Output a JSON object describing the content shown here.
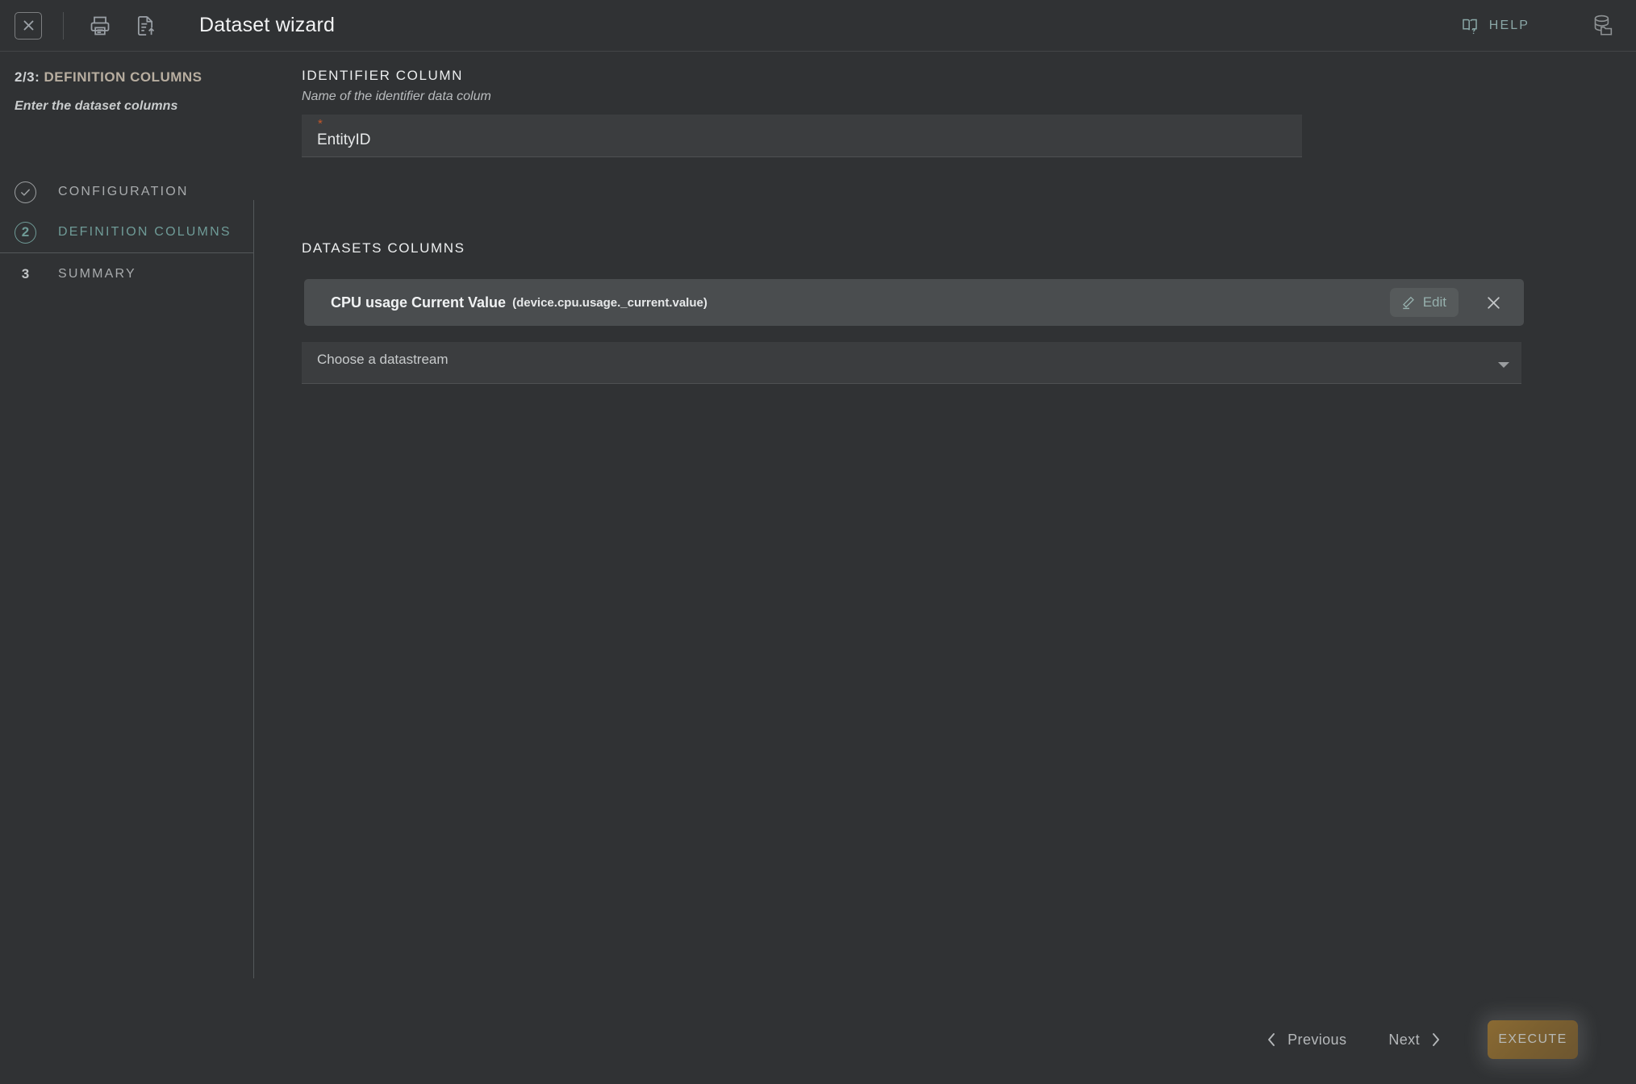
{
  "header": {
    "title": "Dataset wizard",
    "close_icon": "close-box-icon",
    "print_icon": "printer-icon",
    "export_icon": "document-upload-icon",
    "help_label": "HELP",
    "help_icon": "book-question-icon",
    "database_icon": "database-folder-icon"
  },
  "sidebar": {
    "step_number": "2/3:",
    "step_title": "DEFINITION COLUMNS",
    "step_subtitle": "Enter the dataset columns",
    "steps": [
      {
        "badge": "✓",
        "label": "CONFIGURATION",
        "state": "done"
      },
      {
        "badge": "2",
        "label": "DEFINITION COLUMNS",
        "state": "active"
      },
      {
        "badge": "3",
        "label": "SUMMARY",
        "state": "todo"
      }
    ]
  },
  "main": {
    "identifier": {
      "label": "IDENTIFIER COLUMN",
      "description": "Name of the identifier data colum",
      "required_marker": "*",
      "value": "EntityID"
    },
    "datasets_columns": {
      "label": "DATASETS COLUMNS",
      "rows": [
        {
          "title": "CPU usage Current Value",
          "key": "(device.cpu.usage._current.value)",
          "edit_label": "Edit",
          "edit_icon": "pencil-icon",
          "remove_icon": "close-icon"
        }
      ],
      "datastream_placeholder": "Choose a datastream",
      "datastream_caret_icon": "chevron-down-icon"
    }
  },
  "footer": {
    "previous_label": "Previous",
    "previous_icon": "chevron-left-icon",
    "next_label": "Next",
    "next_icon": "chevron-right-icon",
    "execute_label": "EXECUTE"
  },
  "colors": {
    "background": "#303234",
    "accent_teal": "#6f9b97",
    "accent_gold": "#7a5f30",
    "required_orange": "#c4572a",
    "panel": "#3b3d3f",
    "row": "#4a4d4f"
  }
}
